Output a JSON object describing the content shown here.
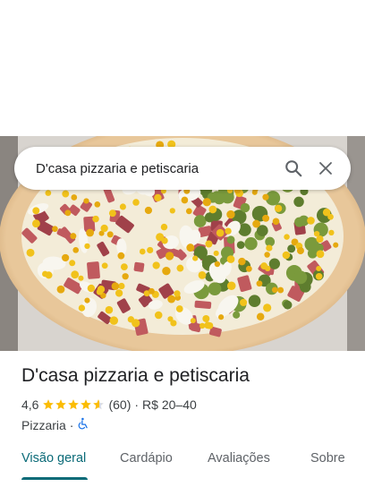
{
  "search": {
    "query": "D'casa pizzaria e petiscaria"
  },
  "place": {
    "name": "D'casa pizzaria e petiscaria",
    "rating": "4,6",
    "stars_value": 4.6,
    "review_count": "(60)",
    "separator": "·",
    "price_range": "R$ 20–40",
    "category": "Pizzaria",
    "category_separator": "·",
    "accessibility_icon": "wheelchair-icon"
  },
  "tabs": [
    {
      "label": "Visão geral",
      "active": true
    },
    {
      "label": "Cardápio",
      "active": false
    },
    {
      "label": "Avaliações",
      "active": false
    },
    {
      "label": "Sobre",
      "active": false
    }
  ],
  "colors": {
    "accent": "#0b6b78",
    "star": "#fbbc04",
    "accessibility": "#1a73e8"
  }
}
